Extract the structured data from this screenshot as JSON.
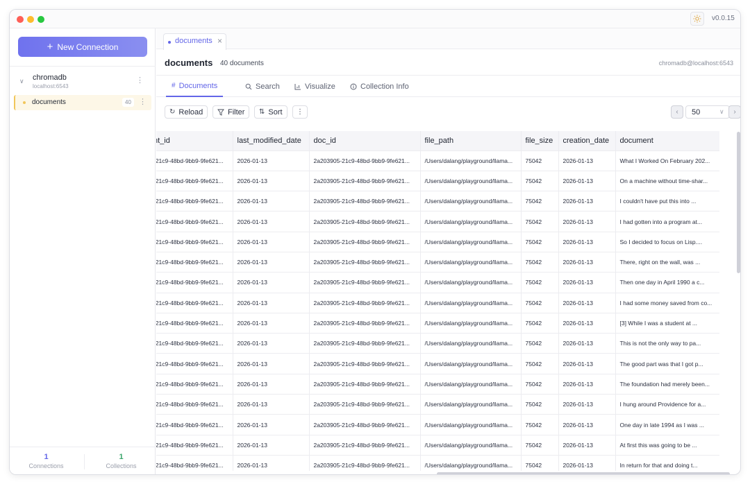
{
  "app": {
    "version": "v0.0.15"
  },
  "sidebar": {
    "new_connection_label": "New Connection",
    "connection": {
      "name": "chromadb",
      "host": "localhost:6543"
    },
    "collection": {
      "name": "documents",
      "count": "40"
    },
    "stats": {
      "connections_value": "1",
      "connections_label": "Connections",
      "collections_value": "1",
      "collections_label": "Collections"
    }
  },
  "tab": {
    "label": "documents"
  },
  "header": {
    "title": "documents",
    "count_text": "40 documents",
    "connection": "chromadb@localhost:6543"
  },
  "view_tabs": {
    "documents": "Documents",
    "search": "Search",
    "visualize": "Visualize",
    "info": "Collection Info"
  },
  "toolbar": {
    "reload": "Reload",
    "filter": "Filter",
    "sort": "Sort",
    "page_size": "50"
  },
  "colors": {
    "accent": "#6366e8",
    "collection_highlight": "#f1c65a",
    "stat_green": "#3aa56b"
  },
  "table": {
    "columns": [
      "nt_id",
      "last_modified_date",
      "doc_id",
      "file_path",
      "file_size",
      "creation_date",
      "document"
    ],
    "rows": [
      [
        "-21c9-48bd-9bb9-9fe621...",
        "2026-01-13",
        "2a203905-21c9-48bd-9bb9-9fe621...",
        "/Users/dalang/playground/llama...",
        "75042",
        "2026-01-13",
        "What I Worked On February 202..."
      ],
      [
        "-21c9-48bd-9bb9-9fe621...",
        "2026-01-13",
        "2a203905-21c9-48bd-9bb9-9fe621...",
        "/Users/dalang/playground/llama...",
        "75042",
        "2026-01-13",
        "On a machine without time-shar..."
      ],
      [
        "-21c9-48bd-9bb9-9fe621...",
        "2026-01-13",
        "2a203905-21c9-48bd-9bb9-9fe621...",
        "/Users/dalang/playground/llama...",
        "75042",
        "2026-01-13",
        "I couldn't have put this into ..."
      ],
      [
        "-21c9-48bd-9bb9-9fe621...",
        "2026-01-13",
        "2a203905-21c9-48bd-9bb9-9fe621...",
        "/Users/dalang/playground/llama...",
        "75042",
        "2026-01-13",
        "I had gotten into a program at..."
      ],
      [
        "-21c9-48bd-9bb9-9fe621...",
        "2026-01-13",
        "2a203905-21c9-48bd-9bb9-9fe621...",
        "/Users/dalang/playground/llama...",
        "75042",
        "2026-01-13",
        "So I decided to focus on Lisp...."
      ],
      [
        "-21c9-48bd-9bb9-9fe621...",
        "2026-01-13",
        "2a203905-21c9-48bd-9bb9-9fe621...",
        "/Users/dalang/playground/llama...",
        "75042",
        "2026-01-13",
        "There, right on the wall, was ..."
      ],
      [
        "-21c9-48bd-9bb9-9fe621...",
        "2026-01-13",
        "2a203905-21c9-48bd-9bb9-9fe621...",
        "/Users/dalang/playground/llama...",
        "75042",
        "2026-01-13",
        "Then one day in April 1990 a c..."
      ],
      [
        "-21c9-48bd-9bb9-9fe621...",
        "2026-01-13",
        "2a203905-21c9-48bd-9bb9-9fe621...",
        "/Users/dalang/playground/llama...",
        "75042",
        "2026-01-13",
        "I had some money saved from co..."
      ],
      [
        "-21c9-48bd-9bb9-9fe621...",
        "2026-01-13",
        "2a203905-21c9-48bd-9bb9-9fe621...",
        "/Users/dalang/playground/llama...",
        "75042",
        "2026-01-13",
        "[3] While I was a student at ..."
      ],
      [
        "-21c9-48bd-9bb9-9fe621...",
        "2026-01-13",
        "2a203905-21c9-48bd-9bb9-9fe621...",
        "/Users/dalang/playground/llama...",
        "75042",
        "2026-01-13",
        "This is not the only way to pa..."
      ],
      [
        "-21c9-48bd-9bb9-9fe621...",
        "2026-01-13",
        "2a203905-21c9-48bd-9bb9-9fe621...",
        "/Users/dalang/playground/llama...",
        "75042",
        "2026-01-13",
        "The good part was that I got p..."
      ],
      [
        "-21c9-48bd-9bb9-9fe621...",
        "2026-01-13",
        "2a203905-21c9-48bd-9bb9-9fe621...",
        "/Users/dalang/playground/llama...",
        "75042",
        "2026-01-13",
        "The foundation had merely been..."
      ],
      [
        "-21c9-48bd-9bb9-9fe621...",
        "2026-01-13",
        "2a203905-21c9-48bd-9bb9-9fe621...",
        "/Users/dalang/playground/llama...",
        "75042",
        "2026-01-13",
        "I hung around Providence for a..."
      ],
      [
        "-21c9-48bd-9bb9-9fe621...",
        "2026-01-13",
        "2a203905-21c9-48bd-9bb9-9fe621...",
        "/Users/dalang/playground/llama...",
        "75042",
        "2026-01-13",
        "One day in late 1994 as I was ..."
      ],
      [
        "-21c9-48bd-9bb9-9fe621...",
        "2026-01-13",
        "2a203905-21c9-48bd-9bb9-9fe621...",
        "/Users/dalang/playground/llama...",
        "75042",
        "2026-01-13",
        "At first this was going to be ..."
      ],
      [
        "-21c9-48bd-9bb9-9fe621...",
        "2026-01-13",
        "2a203905-21c9-48bd-9bb9-9fe621...",
        "/Users/dalang/playground/llama...",
        "75042",
        "2026-01-13",
        "In return for that and doing t..."
      ]
    ]
  }
}
